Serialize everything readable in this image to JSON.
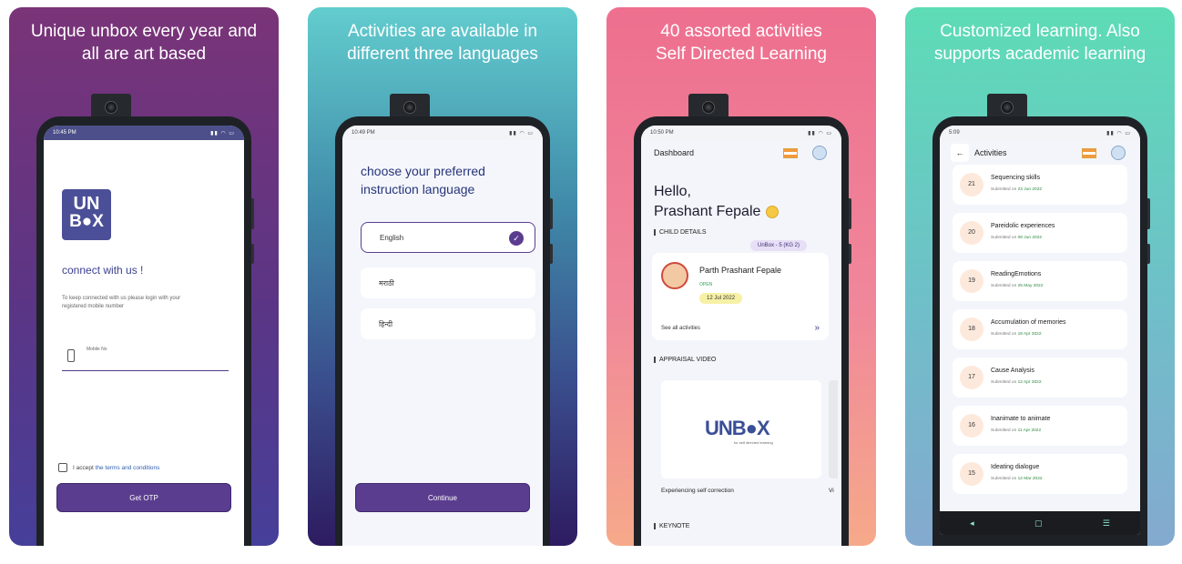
{
  "cards": [
    {
      "headline": "Unique unbox every year and\nall are art based",
      "status_time": "10:45 PM",
      "logo": {
        "line1": "UN",
        "line2": "B●X"
      },
      "connect_title": "connect with us !",
      "connect_subtitle": "To keep connected with us please login with your registered mobile number",
      "mobile_label": "Mobile No",
      "terms_prefix": "I accept",
      "terms_link": "the terms and conditions",
      "cta": "Get OTP"
    },
    {
      "headline": "Activities are available in\ndifferent three languages",
      "status_time": "10:49 PM",
      "title": "choose your preferred instruction language",
      "languages": [
        {
          "label": "English",
          "selected": true
        },
        {
          "label": "मराठी",
          "selected": false
        },
        {
          "label": "हिन्दी",
          "selected": false
        }
      ],
      "cta": "Continue"
    },
    {
      "headline": "40 assorted activities\nSelf Directed Learning",
      "status_time": "10:50 PM",
      "screen_title": "Dashboard",
      "greeting": "Hello,",
      "user_name": "Prashant Fepale",
      "child_section": "CHILD DETAILS",
      "badge": "UnBox - 5 (KG 2)",
      "child_name": "Parth Prashant Fepale",
      "child_status": "OPEN",
      "child_date": "12 Jul 2022",
      "see_all": "See all activities",
      "video_section": "APPRAISAL VIDEO",
      "video_logo": "UNB●X",
      "video_logo_sub": "for self directed learning",
      "video_caption": "Experiencing self correction",
      "video_caption_next": "Vi",
      "keynote_section": "KEYNOTE"
    },
    {
      "headline": "Customized learning. Also\nsupports academic learning",
      "status_time": "5:09",
      "screen_title": "Activities",
      "submitted_prefix": "Submitted on",
      "activities": [
        {
          "num": "21",
          "title": "Sequencing skills",
          "date": "23 Jun 2022"
        },
        {
          "num": "20",
          "title": "Pareidolic experiences",
          "date": "08 Jun 2022"
        },
        {
          "num": "19",
          "title": "ReadingEmotions",
          "date": "25 May 2022"
        },
        {
          "num": "18",
          "title": "Accumulation of memories",
          "date": "18 Apr 2022"
        },
        {
          "num": "17",
          "title": "Cause Analysis",
          "date": "12 Apr 2022"
        },
        {
          "num": "16",
          "title": "Inanimate to animate",
          "date": "11 Apr 2022"
        },
        {
          "num": "15",
          "title": "Ideating dialogue",
          "date": "12 Mar 2022"
        }
      ]
    }
  ],
  "colors": {
    "primary": "#5b3d8f",
    "navy": "#27357a",
    "green_date": "#2b8a3e"
  }
}
